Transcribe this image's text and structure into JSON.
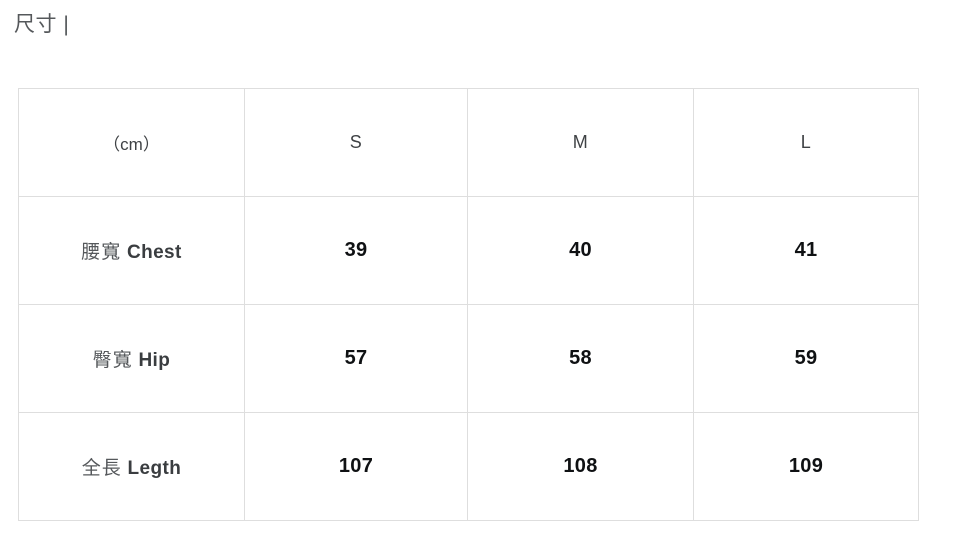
{
  "heading": {
    "text": "尺寸 |"
  },
  "table": {
    "unit_header": "（cm）",
    "size_columns": [
      "S",
      "M",
      "L"
    ],
    "rows": [
      {
        "label_cjk": "腰寬",
        "label_en": "Chest",
        "label_full": "腰寬 Chest",
        "values": [
          "39",
          "40",
          "41"
        ]
      },
      {
        "label_cjk": "臀寬",
        "label_en": "Hip",
        "label_full": "臀寬 Hip",
        "values": [
          "57",
          "58",
          "59"
        ]
      },
      {
        "label_cjk": "全長",
        "label_en": "Legth",
        "label_full": "全長 Legth",
        "values": [
          "107",
          "108",
          "109"
        ]
      }
    ]
  },
  "colors": {
    "background": "#ffffff",
    "border": "#dedede",
    "heading_text": "#55585b",
    "header_text": "#3f4245",
    "label_text": "#3a3d40",
    "value_text": "#0f1113"
  }
}
